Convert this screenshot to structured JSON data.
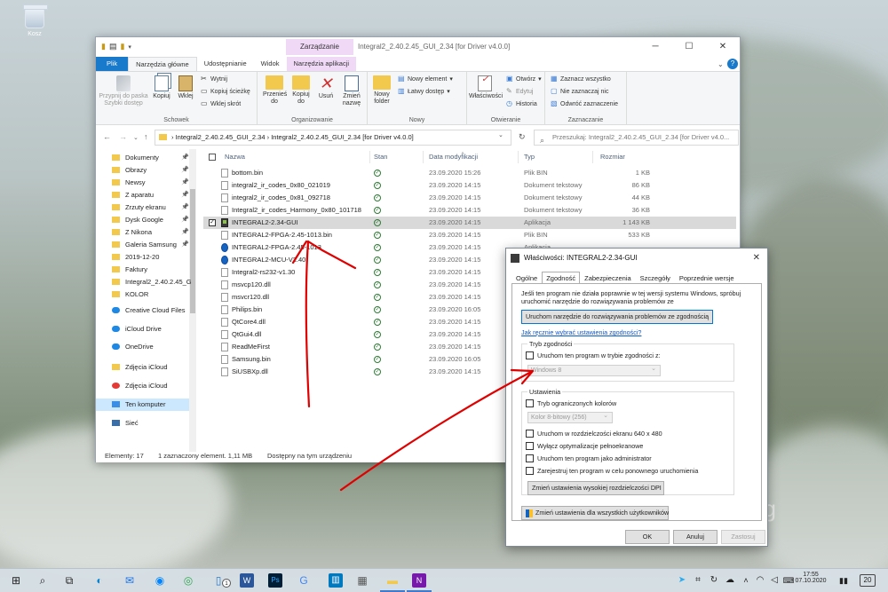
{
  "desktop": {
    "recycle_bin_label": "Kosz",
    "watermark_fragment": "ng"
  },
  "explorer": {
    "quick_access_toolbar": [
      "folder-icon",
      "properties-icon",
      "new-folder-icon",
      "customize-chevron"
    ],
    "context_tab": "Zarządzanie",
    "title": "Integral2_2.40.2.45_GUI_2.34 [for Driver v4.0.0]",
    "window_buttons": [
      "─",
      "☐",
      "✕"
    ],
    "tabs": [
      "Plik",
      "Narzędzia główne",
      "Udostępnianie",
      "Widok",
      "Narzędzia aplikacji"
    ],
    "ribbon": {
      "schowek": {
        "label": "Schowek",
        "pin": "Przypnij do paska Szybki dostęp",
        "copy": "Kopiuj",
        "paste": "Wklej",
        "cut": "Wytnij",
        "copy_path": "Kopiuj ścieżkę",
        "paste_shortcut": "Wklej skrót"
      },
      "organizowanie": {
        "label": "Organizowanie",
        "move_to": "Przenieś do",
        "copy_to": "Kopiuj do",
        "delete": "Usuń",
        "rename": "Zmień nazwę"
      },
      "nowy": {
        "label": "Nowy",
        "new_folder": "Nowy folder",
        "new_item": "Nowy element",
        "easy_access": "Łatwy dostęp"
      },
      "otwieranie": {
        "label": "Otwieranie",
        "properties": "Właściwości",
        "open": "Otwórz",
        "edit": "Edytuj",
        "history": "Historia"
      },
      "zaznaczanie": {
        "label": "Zaznaczanie",
        "select_all": "Zaznacz wszystko",
        "select_none": "Nie zaznaczaj nic",
        "invert": "Odwróć zaznaczenie"
      }
    },
    "breadcrumb": [
      "Integral2_2.40.2.45_GUI_2.34",
      "Integral2_2.40.2.45_GUI_2.34 [for Driver v4.0.0]"
    ],
    "search_placeholder": "Przeszukaj: Integral2_2.40.2.45_GUI_2.34 [for Driver v4.0...",
    "nav": [
      {
        "label": "Dokumenty",
        "pinned": true,
        "icon": "documents-icon"
      },
      {
        "label": "Obrazy",
        "pinned": true,
        "icon": "pictures-icon"
      },
      {
        "label": "Newsy",
        "pinned": true,
        "icon": "folder-icon"
      },
      {
        "label": "Z aparatu",
        "pinned": true,
        "icon": "folder-icon"
      },
      {
        "label": "Zrzuty ekranu",
        "pinned": true,
        "icon": "folder-icon"
      },
      {
        "label": "Dysk Google",
        "pinned": true,
        "icon": "folder-icon"
      },
      {
        "label": "Z Nikona",
        "pinned": true,
        "icon": "folder-icon"
      },
      {
        "label": "Galeria Samsung",
        "pinned": true,
        "icon": "folder-icon"
      },
      {
        "label": "2019-12-20",
        "pinned": false,
        "icon": "folder-icon"
      },
      {
        "label": "Faktury",
        "pinned": false,
        "icon": "folder-icon"
      },
      {
        "label": "Integral2_2.40.2.45_G",
        "pinned": false,
        "icon": "folder-icon"
      },
      {
        "label": "KOLOR",
        "pinned": false,
        "icon": "folder-icon"
      },
      {
        "label": "Creative Cloud Files",
        "pinned": false,
        "icon": "cloud-icon"
      },
      {
        "label": "iCloud Drive",
        "pinned": false,
        "icon": "cloud-icon"
      },
      {
        "label": "OneDrive",
        "pinned": false,
        "icon": "cloud-icon"
      },
      {
        "label": "Zdjęcia iCloud",
        "pinned": false,
        "icon": "folder-icon"
      },
      {
        "label": "Zdjęcia iCloud",
        "pinned": false,
        "icon": "photos-icon"
      },
      {
        "label": "Ten komputer",
        "pinned": false,
        "icon": "pc-icon",
        "selected": true
      },
      {
        "label": "Sieć",
        "pinned": false,
        "icon": "network-icon"
      }
    ],
    "columns": [
      "Nazwa",
      "Stan",
      "Data modyfikacji",
      "Typ",
      "Rozmiar"
    ],
    "files": [
      {
        "name": "bottom.bin",
        "date": "23.09.2020 15:26",
        "type": "Plik BIN",
        "size": "1 KB",
        "icon": "file"
      },
      {
        "name": "integral2_ir_codes_0x80_021019",
        "date": "23.09.2020 14:15",
        "type": "Dokument tekstowy",
        "size": "86 KB",
        "icon": "file"
      },
      {
        "name": "integral2_ir_codes_0x81_092718",
        "date": "23.09.2020 14:15",
        "type": "Dokument tekstowy",
        "size": "44 KB",
        "icon": "file"
      },
      {
        "name": "Integral2_ir_codes_Harmony_0x80_101718",
        "date": "23.09.2020 14:15",
        "type": "Dokument tekstowy",
        "size": "36 KB",
        "icon": "file"
      },
      {
        "name": "INTEGRAL2-2.34-GUI",
        "date": "23.09.2020 14:15",
        "type": "Aplikacja",
        "size": "1 143 KB",
        "icon": "app",
        "selected": true
      },
      {
        "name": "INTEGRAL2-FPGA-2.45-1013.bin",
        "date": "23.09.2020 14:15",
        "type": "Plik BIN",
        "size": "533 KB",
        "icon": "file"
      },
      {
        "name": "INTEGRAL2-FPGA-2.45-1013",
        "date": "23.09.2020 14:15",
        "type": "Aplikacja",
        "size": "",
        "icon": "disc"
      },
      {
        "name": "INTEGRAL2-MCU-V2.40",
        "date": "23.09.2020 14:15",
        "type": "",
        "size": "",
        "icon": "disc"
      },
      {
        "name": "Integral2-rs232-v1.30",
        "date": "23.09.2020 14:15",
        "type": "",
        "size": "",
        "icon": "file"
      },
      {
        "name": "msvcp120.dll",
        "date": "23.09.2020 14:15",
        "type": "",
        "size": "",
        "icon": "file"
      },
      {
        "name": "msvcr120.dll",
        "date": "23.09.2020 14:15",
        "type": "",
        "size": "",
        "icon": "file"
      },
      {
        "name": "Philips.bin",
        "date": "23.09.2020 16:05",
        "type": "",
        "size": "",
        "icon": "file"
      },
      {
        "name": "QtCore4.dll",
        "date": "23.09.2020 14:15",
        "type": "",
        "size": "",
        "icon": "file"
      },
      {
        "name": "QtGui4.dll",
        "date": "23.09.2020 14:15",
        "type": "",
        "size": "",
        "icon": "file"
      },
      {
        "name": "ReadMeFirst",
        "date": "23.09.2020 14:15",
        "type": "",
        "size": "",
        "icon": "file"
      },
      {
        "name": "Samsung.bin",
        "date": "23.09.2020 16:05",
        "type": "",
        "size": "",
        "icon": "file"
      },
      {
        "name": "SiUSBXp.dll",
        "date": "23.09.2020 14:15",
        "type": "",
        "size": "",
        "icon": "file"
      }
    ],
    "status": {
      "count": "Elementy: 17",
      "selection": "1 zaznaczony element. 1,11 MB",
      "availability": "Dostępny na tym urządzeniu"
    }
  },
  "props_dialog": {
    "title": "Właściwości: INTEGRAL2-2.34-GUI",
    "tabs": [
      "Ogólne",
      "Zgodność",
      "Zabezpieczenia",
      "Szczegóły",
      "Poprzednie wersje"
    ],
    "intro": "Jeśli ten program nie działa poprawnie w tej wersji systemu Windows, spróbuj uruchomić narzędzie do rozwiązywania problemów ze",
    "troubleshoot_button": "Uruchom narzędzie do rozwiązywania problemów ze zgodnością",
    "manual_link": "Jak ręcznie wybrać ustawienia zgodności?",
    "compat_group": "Tryb zgodności",
    "compat_checkbox": "Uruchom ten program w trybie zgodności z:",
    "compat_select": "Windows 8",
    "settings_group": "Ustawienia",
    "reduced_color": "Tryb ograniczonych kolorów",
    "color_select": "Kolor 8-bitowy (256)",
    "res_640": "Uruchom w rozdzielczości ekranu 640 x 480",
    "disable_fullscreen": "Wyłącz optymalizacje pełnoekranowe",
    "run_admin": "Uruchom ten program jako administrator",
    "register_restart": "Zarejestruj ten program w celu ponownego uruchomienia",
    "dpi_button": "Zmień ustawienia wysokiej rozdzielczości DPI",
    "all_users_button": "Zmień ustawienia dla wszystkich użytkowników",
    "ok": "OK",
    "cancel": "Anuluj",
    "apply": "Zastosuj"
  },
  "taskbar": {
    "clock_time": "17:55",
    "clock_date": "07.10.2020",
    "notification_count": "20",
    "mail_badge": "1",
    "apps": [
      "start-icon",
      "search-icon",
      "task-view-icon",
      "edge-icon",
      "mail-icon",
      "messenger-icon",
      "chrome-icon",
      "files-icon",
      "word-icon",
      "photoshop-icon",
      "chrome-alt-icon",
      "trello-icon",
      "calculator-icon",
      "explorer-icon",
      "onenote-icon"
    ],
    "tray": [
      "telegram-icon",
      "network-icon",
      "sync-icon",
      "cloud-icon",
      "chevron-up-icon",
      "wifi-icon",
      "volume-icon",
      "keyboard-icon",
      "notification-icon"
    ]
  },
  "colors": {
    "accent": "#1979ca",
    "manage_tab": "#f0d9f6",
    "annotation": "#e00000",
    "selected_row": "#d9d9d9",
    "nav_selected": "#cce8ff"
  }
}
